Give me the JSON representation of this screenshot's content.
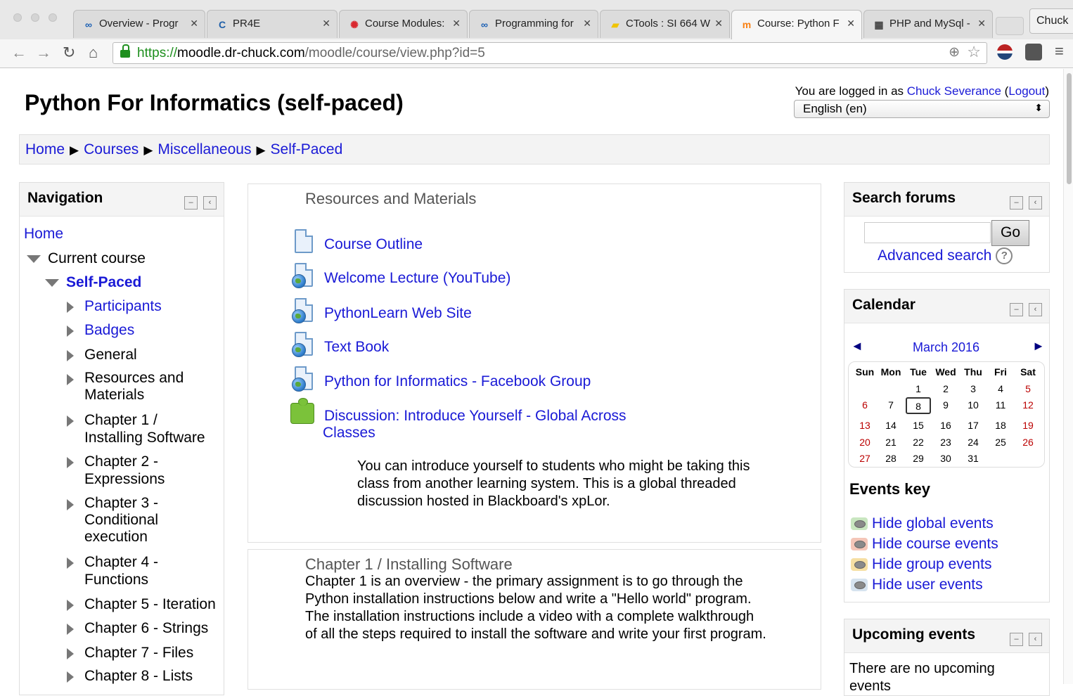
{
  "browser": {
    "tabs": [
      {
        "title": "Overview - Progr",
        "icon": "infinity-icon",
        "color": "#1a5fb4"
      },
      {
        "title": "PR4E",
        "icon": "coursera-icon",
        "color": "#1f5fa8"
      },
      {
        "title": "Course Modules:",
        "icon": "canvas-icon",
        "color": "#d9282f"
      },
      {
        "title": "Programming for",
        "icon": "infinity-icon",
        "color": "#1a5fb4"
      },
      {
        "title": "CTools : SI 664 W",
        "icon": "ctools-icon",
        "color": "#f0c400"
      },
      {
        "title": "Course: Python F",
        "icon": "moodle-icon",
        "color": "#f98012"
      },
      {
        "title": "PHP and MySql -",
        "icon": "image-icon",
        "color": "#444"
      }
    ],
    "profile": "Chuck",
    "url": {
      "scheme": "https://",
      "host": "moodle.dr-chuck.com",
      "path": "/moodle/course/view.php?id=5"
    }
  },
  "page": {
    "title": "Python For Informatics (self-paced)",
    "login_prefix": "You are logged in as ",
    "user": "Chuck Severance",
    "logout": "Logout",
    "language": "English (en)"
  },
  "breadcrumb": [
    "Home",
    "Courses",
    "Miscellaneous",
    "Self-Paced"
  ],
  "navigation": {
    "title": "Navigation",
    "home": "Home",
    "current_course": "Current course",
    "course": "Self-Paced",
    "items": [
      "Participants",
      "Badges",
      "General",
      "Resources and Materials",
      "Chapter 1 / Installing Software",
      "Chapter 2 - Expressions",
      "Chapter 3 - Conditional execution",
      "Chapter 4 - Functions",
      "Chapter 5 - Iteration",
      "Chapter 6 - Strings",
      "Chapter 7 - Files",
      "Chapter 8 - Lists"
    ]
  },
  "main": {
    "section_title": "Resources and Materials",
    "resources": [
      "Course Outline",
      "Welcome Lecture (YouTube)",
      "PythonLearn Web Site",
      "Text Book",
      "Python for Informatics - Facebook Group"
    ],
    "discussion_line1": "Discussion: Introduce Yourself - Global Across",
    "discussion_line2": "Classes",
    "discussion_desc": "You can introduce yourself to students who might be taking this class from another learning system.   This is a global threaded discussion hosted in Blackboard's xpLor.",
    "chapter1_title": "Chapter 1 / Installing Software",
    "chapter1_text": "Chapter 1 is an overview - the primary assignment is to go through the Python installation instructions below and write a \"Hello world\" program.   The installation instructions include a video with a complete walkthrough of all the steps required to install the software and write your first program."
  },
  "search": {
    "title": "Search forums",
    "go": "Go",
    "advanced": "Advanced search",
    "help": "?"
  },
  "calendar": {
    "title": "Calendar",
    "month": "March 2016",
    "prev": "◄",
    "next": "►",
    "days": [
      "Sun",
      "Mon",
      "Tue",
      "Wed",
      "Thu",
      "Fri",
      "Sat"
    ],
    "weeks": [
      [
        "",
        "",
        "1",
        "2",
        "3",
        "4",
        "5"
      ],
      [
        "6",
        "7",
        "8",
        "9",
        "10",
        "11",
        "12"
      ],
      [
        "13",
        "14",
        "15",
        "16",
        "17",
        "18",
        "19"
      ],
      [
        "20",
        "21",
        "22",
        "23",
        "24",
        "25",
        "26"
      ],
      [
        "27",
        "28",
        "29",
        "30",
        "31",
        "",
        ""
      ]
    ],
    "today": "8"
  },
  "events_key": {
    "title": "Events key",
    "items": [
      {
        "label": "Hide global events",
        "color": "#c9e6c0"
      },
      {
        "label": "Hide course events",
        "color": "#f4c6b8"
      },
      {
        "label": "Hide group events",
        "color": "#f6dfa3"
      },
      {
        "label": "Hide user events",
        "color": "#d6e3ef"
      }
    ]
  },
  "upcoming": {
    "title": "Upcoming events",
    "text": "There are no upcoming events"
  }
}
